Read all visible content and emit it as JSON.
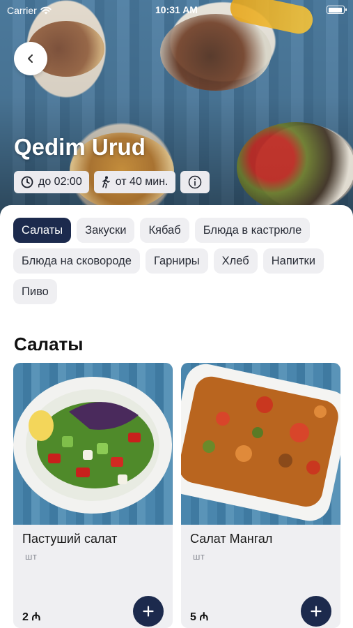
{
  "status_bar": {
    "carrier": "Carrier",
    "time": "10:31 AM"
  },
  "restaurant": {
    "name": "Qedim Urud",
    "hours": "до 02:00",
    "delivery_time": "от 40 мин."
  },
  "categories": [
    {
      "label": "Салаты",
      "active": true
    },
    {
      "label": "Закуски",
      "active": false
    },
    {
      "label": "Кябаб",
      "active": false
    },
    {
      "label": "Блюда в кастрюле",
      "active": false
    },
    {
      "label": "Блюда на сковороде",
      "active": false
    },
    {
      "label": "Гарниры",
      "active": false
    },
    {
      "label": "Хлеб",
      "active": false
    },
    {
      "label": "Напитки",
      "active": false
    },
    {
      "label": "Пиво",
      "active": false
    }
  ],
  "section_title": "Салаты",
  "products": [
    {
      "name": "Пастуший салат",
      "unit": "шт",
      "price": "2 ₼"
    },
    {
      "name": "Салат Мангал",
      "unit": "шт",
      "price": "5 ₼"
    }
  ],
  "icons": {
    "back": "chevron-left-icon",
    "clock": "clock-icon",
    "walk": "walking-person-icon",
    "info": "info-icon",
    "add": "plus-icon"
  },
  "colors": {
    "accent": "#1c2a4d",
    "chip_bg": "#ecebef",
    "card_bg": "#efeff2"
  }
}
